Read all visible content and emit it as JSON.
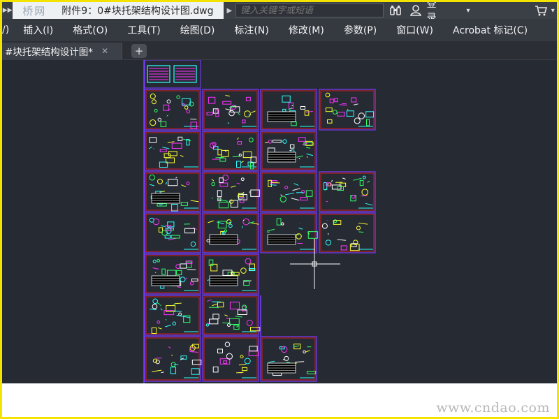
{
  "titlebar": {
    "logo_text": "桥网",
    "document_title": "附件9：0#块托架结构设计图.dwg",
    "search_placeholder": "键入关键字或短语",
    "login_label": "登录"
  },
  "menu": {
    "items": [
      "/)",
      "插入(I)",
      "格式(O)",
      "工具(T)",
      "绘图(D)",
      "标注(N)",
      "修改(M)",
      "参数(P)",
      "窗口(W)",
      "Acrobat 标记(C)"
    ]
  },
  "tabs": {
    "active_label": "#块托架结构设计图*",
    "close_glyph": "✕",
    "new_tab_glyph": "+"
  },
  "watermark": "www.cndao.com",
  "icons": [
    "app-menu-icon",
    "search-arrow-icon",
    "binoculars-icon",
    "user-icon",
    "cart-icon",
    "close-icon",
    "crosshair-cursor-icon"
  ],
  "colors": {
    "frame_border": "#f2e400",
    "sheet_border": "#ff1a1a",
    "sheet_outline": "#7a3cff",
    "drawing_magenta": "#ff33ff",
    "drawing_cyan": "#33ffff",
    "drawing_yellow": "#ffff33",
    "drawing_green": "#33ff66",
    "canvas_bg": "#252a33"
  }
}
